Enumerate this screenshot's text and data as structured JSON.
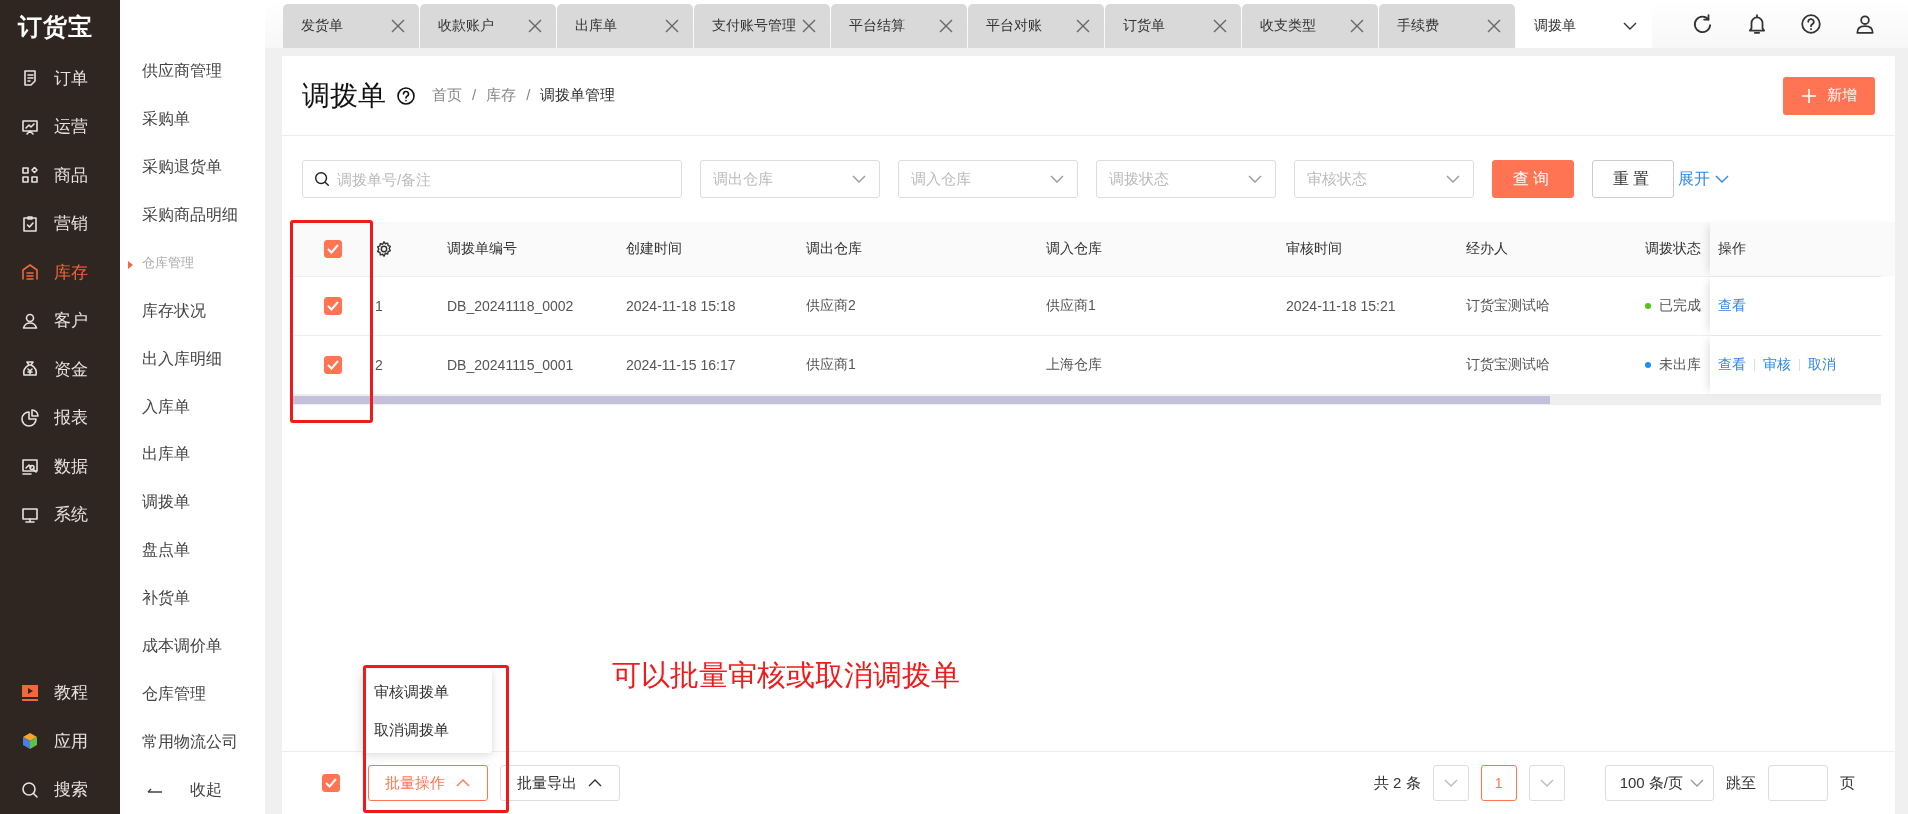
{
  "logo": "订货宝",
  "nav": {
    "items": [
      {
        "label": "订单",
        "selected": false
      },
      {
        "label": "运营",
        "selected": false
      },
      {
        "label": "商品",
        "selected": false
      },
      {
        "label": "营销",
        "selected": false
      },
      {
        "label": "库存",
        "selected": true
      },
      {
        "label": "客户",
        "selected": false
      },
      {
        "label": "资金",
        "selected": false
      },
      {
        "label": "报表",
        "selected": false
      },
      {
        "label": "数据",
        "selected": false
      },
      {
        "label": "系统",
        "selected": false
      }
    ],
    "bottom_items": [
      {
        "label": "教程"
      },
      {
        "label": "应用"
      },
      {
        "label": "搜索"
      }
    ]
  },
  "submenu": {
    "items": [
      {
        "label": "供应商管理",
        "kind": "link"
      },
      {
        "label": "采购单",
        "kind": "link"
      },
      {
        "label": "采购退货单",
        "kind": "link"
      },
      {
        "label": "采购商品明细",
        "kind": "link"
      },
      {
        "label": "仓库管理",
        "kind": "group"
      },
      {
        "label": "库存状况",
        "kind": "link"
      },
      {
        "label": "出入库明细",
        "kind": "link"
      },
      {
        "label": "入库单",
        "kind": "link"
      },
      {
        "label": "出库单",
        "kind": "link"
      },
      {
        "label": "调拨单",
        "kind": "link"
      },
      {
        "label": "盘点单",
        "kind": "link"
      },
      {
        "label": "补货单",
        "kind": "link"
      },
      {
        "label": "成本调价单",
        "kind": "link"
      },
      {
        "label": "仓库管理",
        "kind": "link"
      },
      {
        "label": "常用物流公司",
        "kind": "link"
      }
    ],
    "collapse": "收起"
  },
  "tabs": [
    {
      "label": "发货单",
      "selected": false
    },
    {
      "label": "收款账户",
      "selected": false
    },
    {
      "label": "出库单",
      "selected": false
    },
    {
      "label": "支付账号管理",
      "selected": false
    },
    {
      "label": "平台结算",
      "selected": false
    },
    {
      "label": "平台对账",
      "selected": false
    },
    {
      "label": "订货单",
      "selected": false
    },
    {
      "label": "收支类型",
      "selected": false
    },
    {
      "label": "手续费",
      "selected": false
    },
    {
      "label": "调拨单",
      "selected": true
    }
  ],
  "page": {
    "title": "调拨单",
    "breadcrumb": [
      "首页",
      "库存",
      "调拨单管理"
    ],
    "breadcrumb_separator": "/",
    "add_button": "新增"
  },
  "filters": {
    "search": {
      "placeholder": "调拨单号/备注"
    },
    "selects": [
      {
        "placeholder": "调出仓库"
      },
      {
        "placeholder": "调入仓库"
      },
      {
        "placeholder": "调拨状态"
      },
      {
        "placeholder": "审核状态"
      }
    ],
    "query_button": "查询",
    "reset_button": "重置",
    "expand_link": "展开"
  },
  "table": {
    "all_checked": true,
    "columns": [
      "调拨单编号",
      "创建时间",
      "调出仓库",
      "调入仓库",
      "审核时间",
      "经办人",
      "调拨状态",
      "操作"
    ],
    "rows": [
      {
        "checked": true,
        "index": "1",
        "code": "DB_20241118_0002",
        "created": "2024-11-18 15:18",
        "from": "供应商2",
        "to": "供应商1",
        "reviewed": "2024-11-18 15:21",
        "handler": "订货宝测试哈",
        "status": "已完成",
        "color": "#52c41a",
        "actions": [
          "查看"
        ]
      },
      {
        "checked": true,
        "index": "2",
        "code": "DB_20241115_0001",
        "created": "2024-11-15 16:17",
        "from": "供应商1",
        "to": "上海仓库",
        "reviewed": "",
        "handler": "订货宝测试哈",
        "status": "未出库",
        "color": "#1890ff",
        "actions": [
          "查看",
          "审核",
          "取消"
        ]
      }
    ]
  },
  "bottom": {
    "all_checked": true,
    "batch_button": "批量操作",
    "batch_menu_open": true,
    "batch_menu": [
      "审核调拨单",
      "取消调拨单"
    ],
    "export_button": "批量导出",
    "total": "共 2 条",
    "pages": [
      {
        "label": "1",
        "selected": true
      }
    ],
    "page_size": "100 条/页",
    "jump_label": "跳至",
    "page_unit": "页"
  },
  "annotation": "可以批量审核或取消调拨单"
}
